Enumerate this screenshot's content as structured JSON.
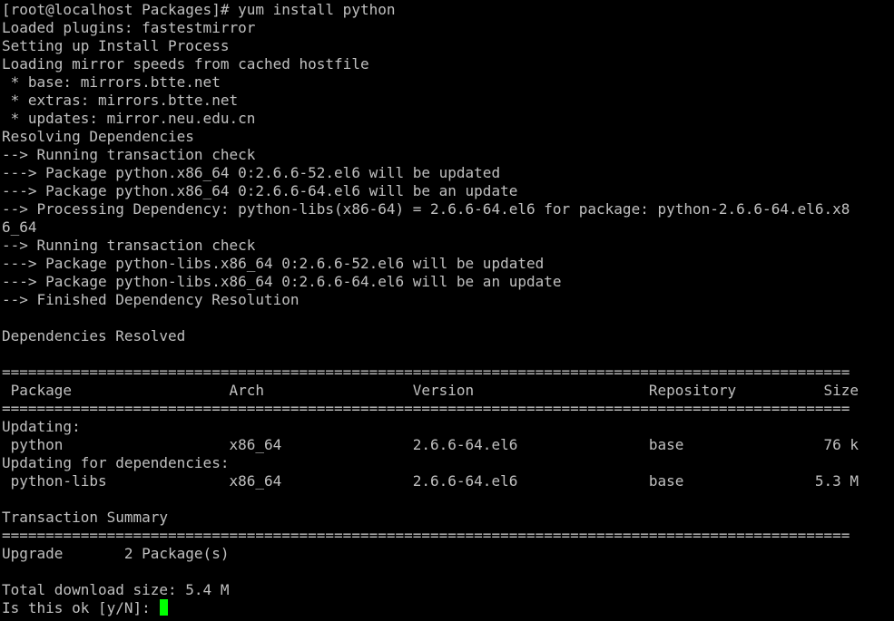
{
  "terminal": {
    "text_color": "#c0c0c0",
    "background_color": "#000000",
    "cursor_color": "#00ff00",
    "lines": [
      "[root@localhost Packages]# yum install python",
      "Loaded plugins: fastestmirror",
      "Setting up Install Process",
      "Loading mirror speeds from cached hostfile",
      " * base: mirrors.btte.net",
      " * extras: mirrors.btte.net",
      " * updates: mirror.neu.edu.cn",
      "Resolving Dependencies",
      "--> Running transaction check",
      "---> Package python.x86_64 0:2.6.6-52.el6 will be updated",
      "---> Package python.x86_64 0:2.6.6-64.el6 will be an update",
      "--> Processing Dependency: python-libs(x86-64) = 2.6.6-64.el6 for package: python-2.6.6-64.el6.x8",
      "6_64",
      "--> Running transaction check",
      "---> Package python-libs.x86_64 0:2.6.6-52.el6 will be updated",
      "---> Package python-libs.x86_64 0:2.6.6-64.el6 will be an update",
      "--> Finished Dependency Resolution",
      "",
      "Dependencies Resolved",
      "",
      "=================================================================================================",
      " Package                  Arch                 Version                    Repository          Size",
      "=================================================================================================",
      "Updating:",
      " python                   x86_64               2.6.6-64.el6               base                76 k",
      "Updating for dependencies:",
      " python-libs              x86_64               2.6.6-64.el6               base               5.3 M",
      "",
      "Transaction Summary",
      "=================================================================================================",
      "Upgrade       2 Package(s)",
      "",
      "Total download size: 5.4 M",
      "Is this ok [y/N]: "
    ]
  }
}
